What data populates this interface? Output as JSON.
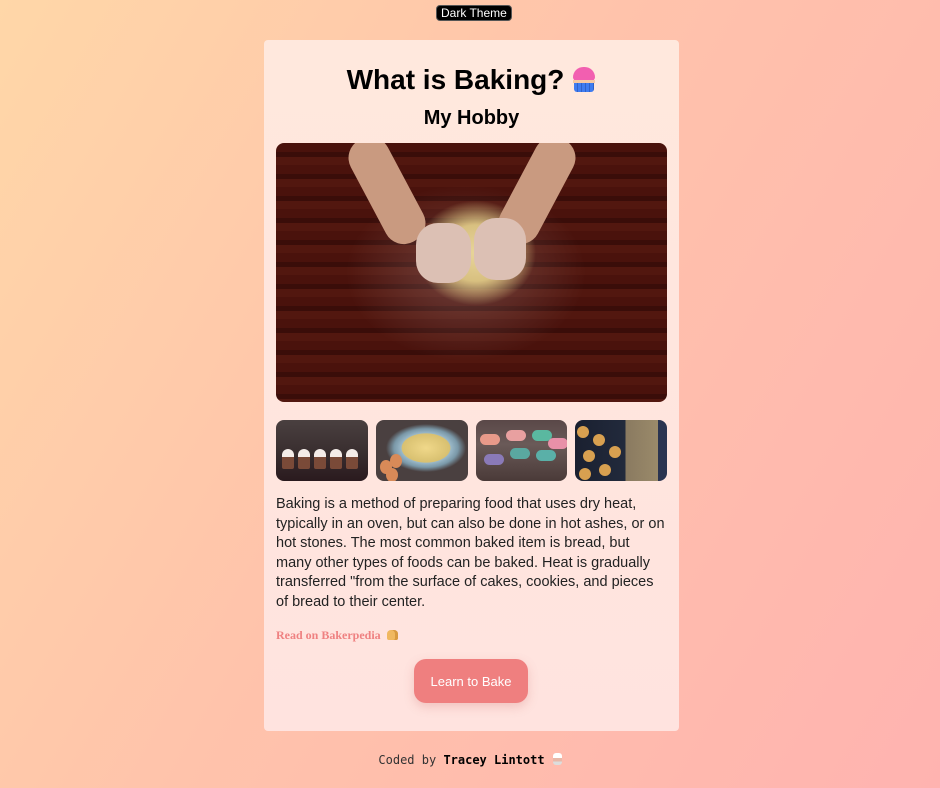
{
  "theme_toggle": {
    "label": "Dark Theme"
  },
  "card": {
    "title": "What is Baking?",
    "title_icon": "cupcake-icon",
    "subtitle": "My Hobby",
    "hero_image": {
      "alt": "Hands kneading crumbly dough on a dark wooden table dusted with flour"
    },
    "thumbnails": [
      {
        "alt": "Frosted cupcakes in a row"
      },
      {
        "alt": "Batter being mixed in a blue bowl with eggs"
      },
      {
        "alt": "Colorful macarons"
      },
      {
        "alt": "Blueberry muffins on a tray"
      }
    ],
    "description": "Baking is a method of preparing food that uses dry heat, typically in an oven, but can also be done in hot ashes, or on hot stones. The most common baked item is bread, but many other types of foods can be baked. Heat is gradually transferred \"from the surface of cakes, cookies, and pieces of bread to their center.",
    "read_link": {
      "label": "Read on Bakerpedia",
      "icon": "bread-icon"
    },
    "cta_button": {
      "label": "Learn to Bake"
    }
  },
  "footer": {
    "prefix": "Coded by",
    "author": "Tracey Lintott",
    "icon": "chef-icon"
  },
  "colors": {
    "accent": "#ef7f7f",
    "link": "#ef8181",
    "card_bg": "#ffe6de",
    "toggle_bg": "#000000"
  }
}
